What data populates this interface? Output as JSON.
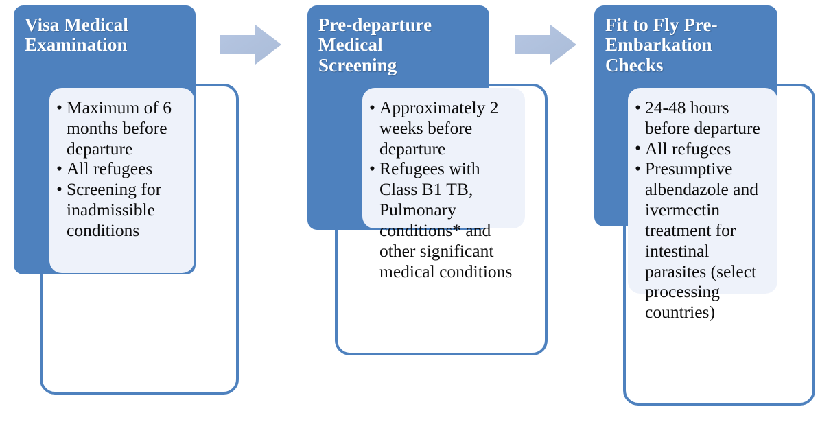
{
  "diagram": {
    "title": "Refugee medical screening timeline",
    "colors": {
      "header_blue": "#4e81be",
      "outline_blue": "#4e81be",
      "body_panel": "#eef2fa",
      "arrow_fill": "#b2c4e0",
      "header_text": "#ffffff",
      "body_text": "#0d0d0d",
      "page_background": "#ffffff"
    },
    "steps": [
      {
        "id": "visa-medical-examination",
        "title": "Visa Medical\nExamination",
        "bullets": [
          "Maximum of 6 months before departure",
          "All refugees",
          "Screening for inadmissible conditions"
        ]
      },
      {
        "id": "pre-departure-medical-screening",
        "title": "Pre-departure\nMedical\nScreening",
        "bullets": [
          "Approximately 2 weeks before departure",
          "Refugees with Class B1 TB, Pulmonary conditions* and other significant medical conditions"
        ]
      },
      {
        "id": "fit-to-fly-pre-embarkation-checks",
        "title": "Fit to Fly Pre-\nEmbarkation\nChecks",
        "bullets": [
          "24-48 hours before departure",
          "All refugees",
          "Presumptive albendazole and ivermectin treatment for intestinal parasites (select processing countries)"
        ]
      }
    ],
    "connectors": [
      {
        "id": "arrow-step1-to-step2",
        "icon": "right-block-arrow-icon"
      },
      {
        "id": "arrow-step2-to-step3",
        "icon": "right-block-arrow-icon"
      }
    ]
  }
}
